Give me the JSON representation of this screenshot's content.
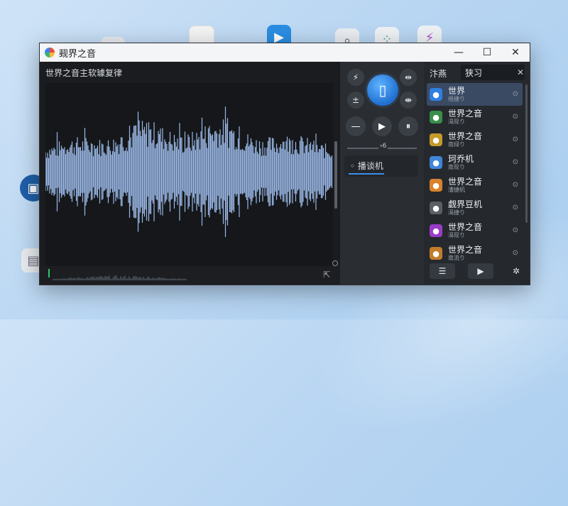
{
  "colors": {
    "accent": "#3b8ee8",
    "waveform": "#9ab8e6",
    "window_bg": "#1f2226"
  },
  "window": {
    "title": "觋界之音"
  },
  "editor": {
    "title": "世界之音主软璩复律"
  },
  "controls": {
    "slider_label": "›6"
  },
  "device": {
    "label": "◦ 播谈机"
  },
  "playlist": {
    "header": "汴燕",
    "search_value": "狭习",
    "items": [
      {
        "name": "世界",
        "sub": "摇捷り",
        "icon": "blue-diamond-icon",
        "color": "#2f7fe0"
      },
      {
        "name": "世界之音",
        "sub": "渴现り",
        "icon": "window-icon",
        "color": "#3a8f4a"
      },
      {
        "name": "世界之音",
        "sub": "南绿り",
        "icon": "note-icon",
        "color": "#c59a2b"
      },
      {
        "name": "珂乔机",
        "sub": "南现り",
        "icon": "folder-icon",
        "color": "#3f86d8"
      },
      {
        "name": "世界之音",
        "sub": "漕捷机",
        "icon": "star-icon",
        "color": "#d9822b"
      },
      {
        "name": "觑界豆机",
        "sub": "渴捷り",
        "icon": "speaker-icon",
        "color": "#5a5f66"
      },
      {
        "name": "世界之音",
        "sub": "渴现り",
        "icon": "x-icon",
        "color": "#9b3cc9"
      },
      {
        "name": "世界之音",
        "sub": "南流り",
        "icon": "person-icon",
        "color": "#c27c2c"
      }
    ]
  }
}
